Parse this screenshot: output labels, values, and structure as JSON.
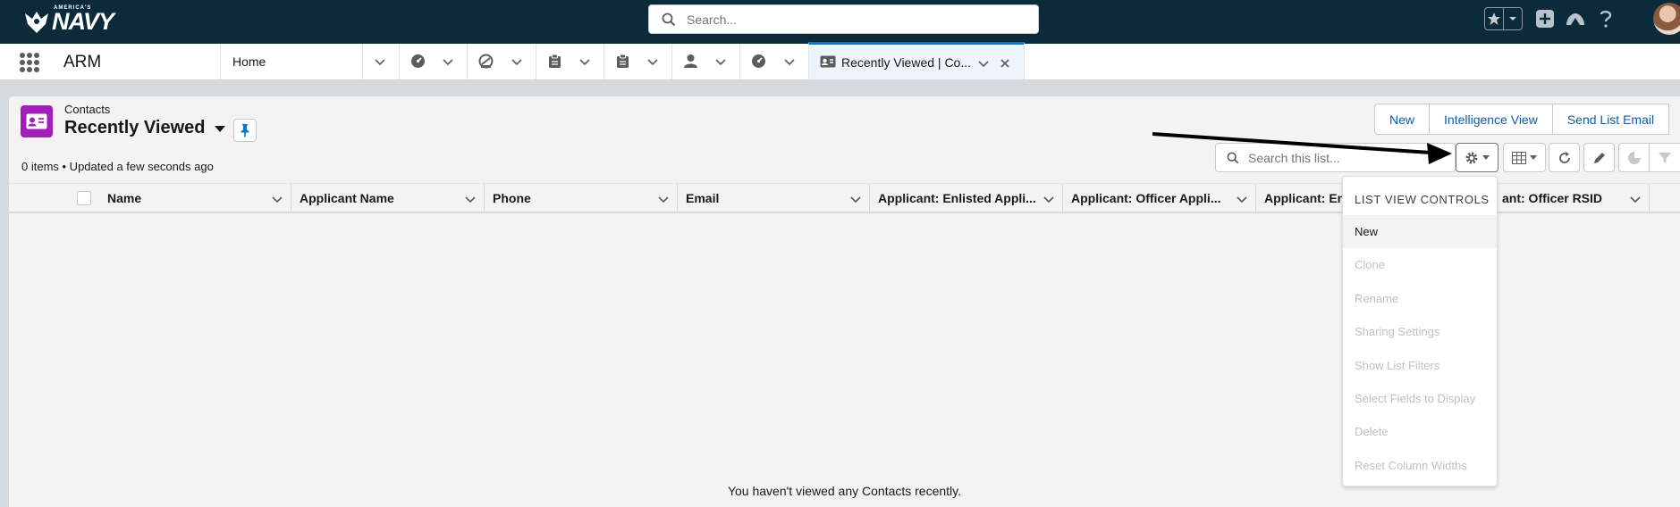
{
  "header": {
    "logo_sub": "AMERICA'S",
    "logo_text": "NAVY",
    "search_placeholder": "Search...",
    "icons": [
      "favorites-star-icon",
      "favorites-dropdown-icon",
      "global-actions-icon",
      "trailhead-icon",
      "help-icon",
      "user-avatar"
    ]
  },
  "nav": {
    "app_name": "ARM",
    "tabs": [
      {
        "label": "Home",
        "icon": ""
      },
      {
        "label": "",
        "icon": "dashboard-icon"
      },
      {
        "label": "",
        "icon": "opportunity-icon"
      },
      {
        "label": "",
        "icon": "clipboard-icon"
      },
      {
        "label": "",
        "icon": "clipboard-icon"
      },
      {
        "label": "",
        "icon": "user-icon"
      },
      {
        "label": "",
        "icon": "dashboard-icon"
      }
    ],
    "active_tab": {
      "label": "Recently Viewed | Co...",
      "icon": "contact-card-icon"
    }
  },
  "list_view": {
    "object_label": "Contacts",
    "list_name": "Recently Viewed",
    "status": "0 items • Updated a few seconds ago",
    "buttons": {
      "new": "New",
      "intelligence": "Intelligence View",
      "send_email": "Send List Email"
    },
    "search_placeholder": "Search this list...",
    "columns": [
      "Name",
      "Applicant Name",
      "Phone",
      "Email",
      "Applicant: Enlisted Appli...",
      "Applicant: Officer Appli...",
      "Applicant: En",
      "ant: Officer RSID"
    ],
    "empty_message": "You haven't viewed any Contacts recently."
  },
  "menu": {
    "title": "LIST VIEW CONTROLS",
    "items": [
      {
        "label": "New",
        "enabled": true
      },
      {
        "label": "Clone",
        "enabled": false
      },
      {
        "label": "Rename",
        "enabled": false
      },
      {
        "label": "Sharing Settings",
        "enabled": false
      },
      {
        "label": "Show List Filters",
        "enabled": false
      },
      {
        "label": "Select Fields to Display",
        "enabled": false
      },
      {
        "label": "Delete",
        "enabled": false
      },
      {
        "label": "Reset Column Widths",
        "enabled": false
      }
    ]
  },
  "colors": {
    "header_bg": "#0b2a3a",
    "brand_blue": "#0176d3",
    "contact_icon_bg": "#a01fb8"
  }
}
